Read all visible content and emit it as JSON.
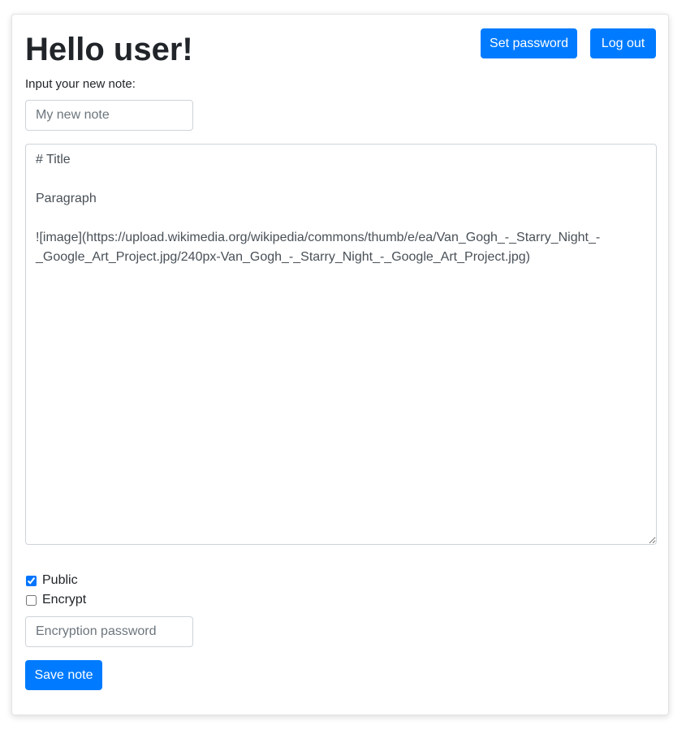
{
  "header": {
    "title": "Hello user!",
    "set_password_label": "Set password",
    "logout_label": "Log out"
  },
  "note_form": {
    "prompt_label": "Input your new note:",
    "note_title": {
      "placeholder": "My new note",
      "value": ""
    },
    "note_body": "# Title\n\nParagraph\n\n![image](https://upload.wikimedia.org/wikipedia/commons/thumb/e/ea/Van_Gogh_-_Starry_Night_-_Google_Art_Project.jpg/240px-Van_Gogh_-_Starry_Night_-_Google_Art_Project.jpg)",
    "public": {
      "label": "Public",
      "checked": true
    },
    "encrypt": {
      "label": "Encrypt",
      "checked": false
    },
    "encryption_password": {
      "placeholder": "Encryption password",
      "value": ""
    },
    "save_label": "Save note"
  },
  "colors": {
    "primary": "#007bff",
    "text": "#212529",
    "border": "#ced4da"
  }
}
